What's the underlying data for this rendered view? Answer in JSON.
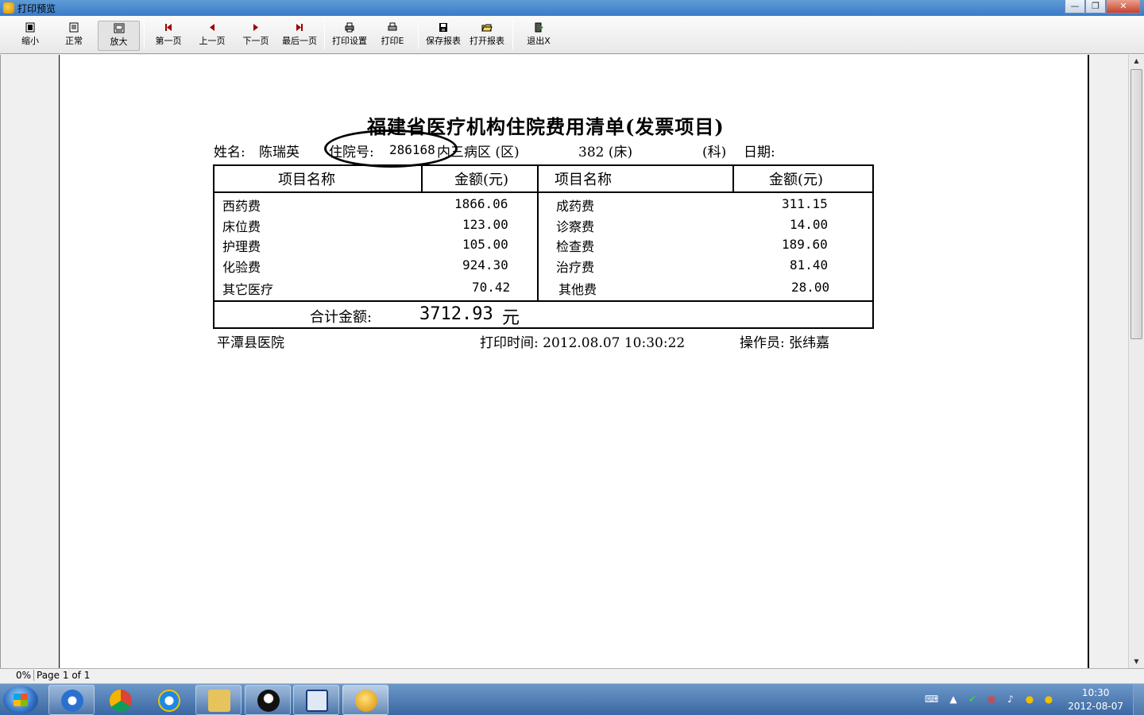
{
  "window": {
    "title": "打印预览",
    "minimize_glyph": "—",
    "restore_glyph": "❐",
    "close_glyph": "✕"
  },
  "toolbar": {
    "zoom_out": "缩小",
    "normal": "正常",
    "zoom_in": "放大",
    "first_page": "第一页",
    "prev_page": "上一页",
    "next_page": "下一页",
    "last_page": "最后一页",
    "print_setup": "打印设置",
    "print": "打印E",
    "save_report": "保存报表",
    "open_report": "打开报表",
    "exit": "退出X"
  },
  "report": {
    "title": "福建省医疗机构住院费用清单(发票项目)",
    "name_label": "姓名:",
    "name": "陈瑞英",
    "admission_label": "住院号:",
    "admission_no": "286168",
    "ward": "内三病区 (区)",
    "bed": "382 (床)",
    "dept": "(科)",
    "date_label": "日期:",
    "headers": {
      "item_left": "项目名称",
      "amount_left": "金额(元)",
      "item_right": "项目名称",
      "amount_right": "金额(元)"
    },
    "rows": [
      {
        "left_item": "西药费",
        "left_amount": "1866.06",
        "right_item": "成药费",
        "right_amount": "311.15"
      },
      {
        "left_item": "床位费",
        "left_amount": "123.00",
        "right_item": "诊察费",
        "right_amount": "14.00"
      },
      {
        "left_item": "护理费",
        "left_amount": "105.00",
        "right_item": "检查费",
        "right_amount": "189.60"
      },
      {
        "left_item": "化验费",
        "left_amount": "924.30",
        "right_item": "治疗费",
        "right_amount": "81.40"
      },
      {
        "left_item": "其它医疗",
        "left_amount": "70.42",
        "right_item": "其他费",
        "right_amount": "28.00"
      }
    ],
    "total_label": "合计金额:",
    "total_value": "3712.93",
    "total_unit": "元",
    "hospital": "平潭县医院",
    "print_time": "打印时间: 2012.08.07  10:30:22",
    "operator": "操作员: 张纬嘉"
  },
  "status": {
    "zoom": "0%",
    "page": "Page 1 of 1"
  },
  "taskbar": {
    "time": "10:30",
    "date": "2012-08-07"
  }
}
